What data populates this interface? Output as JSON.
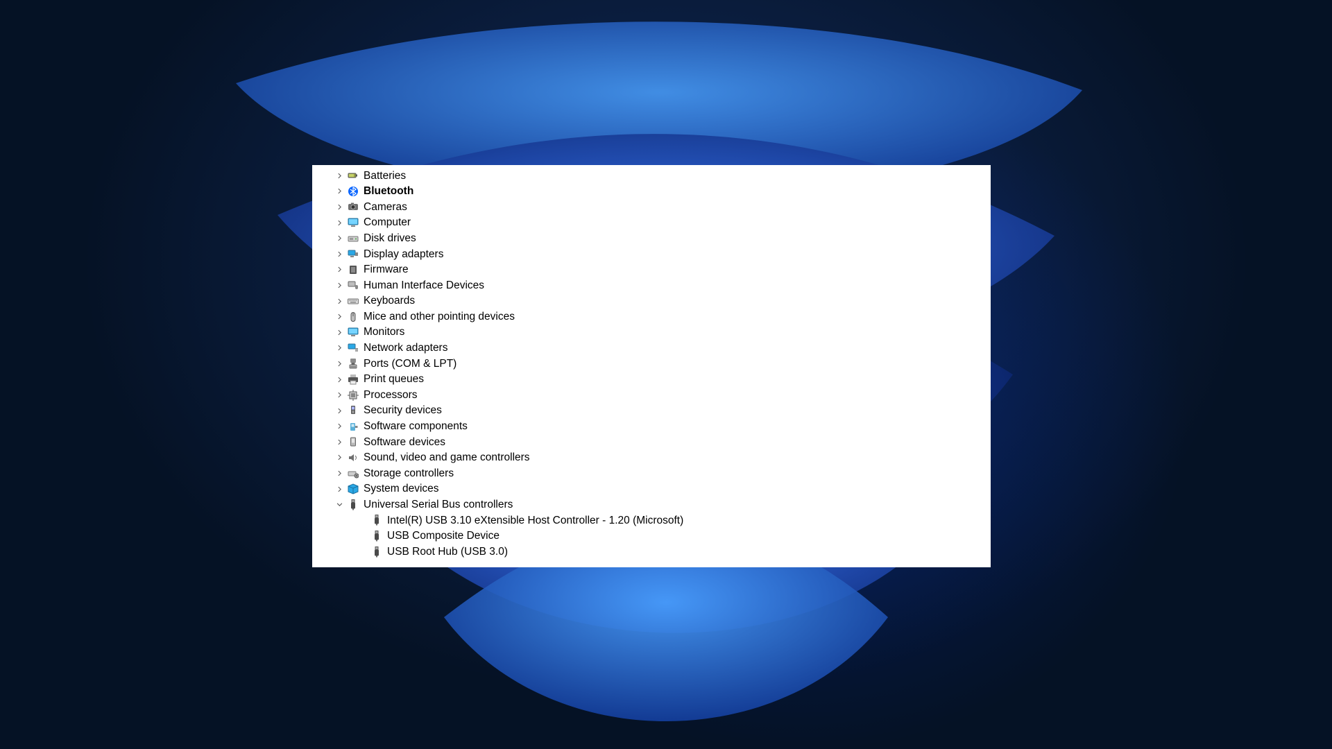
{
  "deviceTree": {
    "categories": [
      {
        "id": "batteries",
        "label": "Batteries",
        "icon": "battery-icon",
        "expanded": false
      },
      {
        "id": "bluetooth",
        "label": "Bluetooth",
        "icon": "bluetooth-icon",
        "expanded": false,
        "bold": true
      },
      {
        "id": "cameras",
        "label": "Cameras",
        "icon": "camera-icon",
        "expanded": false
      },
      {
        "id": "computer",
        "label": "Computer",
        "icon": "monitor-icon",
        "expanded": false
      },
      {
        "id": "disk-drives",
        "label": "Disk drives",
        "icon": "drive-icon",
        "expanded": false
      },
      {
        "id": "display-adapters",
        "label": "Display adapters",
        "icon": "display-adapter-icon",
        "expanded": false
      },
      {
        "id": "firmware",
        "label": "Firmware",
        "icon": "firmware-icon",
        "expanded": false
      },
      {
        "id": "hid",
        "label": "Human Interface Devices",
        "icon": "hid-icon",
        "expanded": false
      },
      {
        "id": "keyboards",
        "label": "Keyboards",
        "icon": "keyboard-icon",
        "expanded": false
      },
      {
        "id": "mice",
        "label": "Mice and other pointing devices",
        "icon": "mouse-icon",
        "expanded": false
      },
      {
        "id": "monitors",
        "label": "Monitors",
        "icon": "monitor-icon",
        "expanded": false
      },
      {
        "id": "network",
        "label": "Network adapters",
        "icon": "network-icon",
        "expanded": false
      },
      {
        "id": "ports",
        "label": "Ports (COM & LPT)",
        "icon": "port-icon",
        "expanded": false
      },
      {
        "id": "print-queues",
        "label": "Print queues",
        "icon": "printer-icon",
        "expanded": false
      },
      {
        "id": "processors",
        "label": "Processors",
        "icon": "cpu-icon",
        "expanded": false
      },
      {
        "id": "security",
        "label": "Security devices",
        "icon": "security-icon",
        "expanded": false
      },
      {
        "id": "sw-components",
        "label": "Software components",
        "icon": "sw-component-icon",
        "expanded": false
      },
      {
        "id": "sw-devices",
        "label": "Software devices",
        "icon": "sw-device-icon",
        "expanded": false
      },
      {
        "id": "sound",
        "label": "Sound, video and game controllers",
        "icon": "speaker-icon",
        "expanded": false
      },
      {
        "id": "storage-ctrl",
        "label": "Storage controllers",
        "icon": "storage-ctrl-icon",
        "expanded": false
      },
      {
        "id": "system-devices",
        "label": "System devices",
        "icon": "system-icon",
        "expanded": false
      },
      {
        "id": "usb",
        "label": "Universal Serial Bus controllers",
        "icon": "usb-icon",
        "expanded": true,
        "children": [
          {
            "id": "usb-xhci",
            "label": "Intel(R) USB 3.10 eXtensible Host Controller - 1.20 (Microsoft)",
            "icon": "usb-icon"
          },
          {
            "id": "usb-composite",
            "label": "USB Composite Device",
            "icon": "usb-icon"
          },
          {
            "id": "usb-roothub",
            "label": "USB Root Hub (USB 3.0)",
            "icon": "usb-icon"
          }
        ]
      }
    ]
  }
}
